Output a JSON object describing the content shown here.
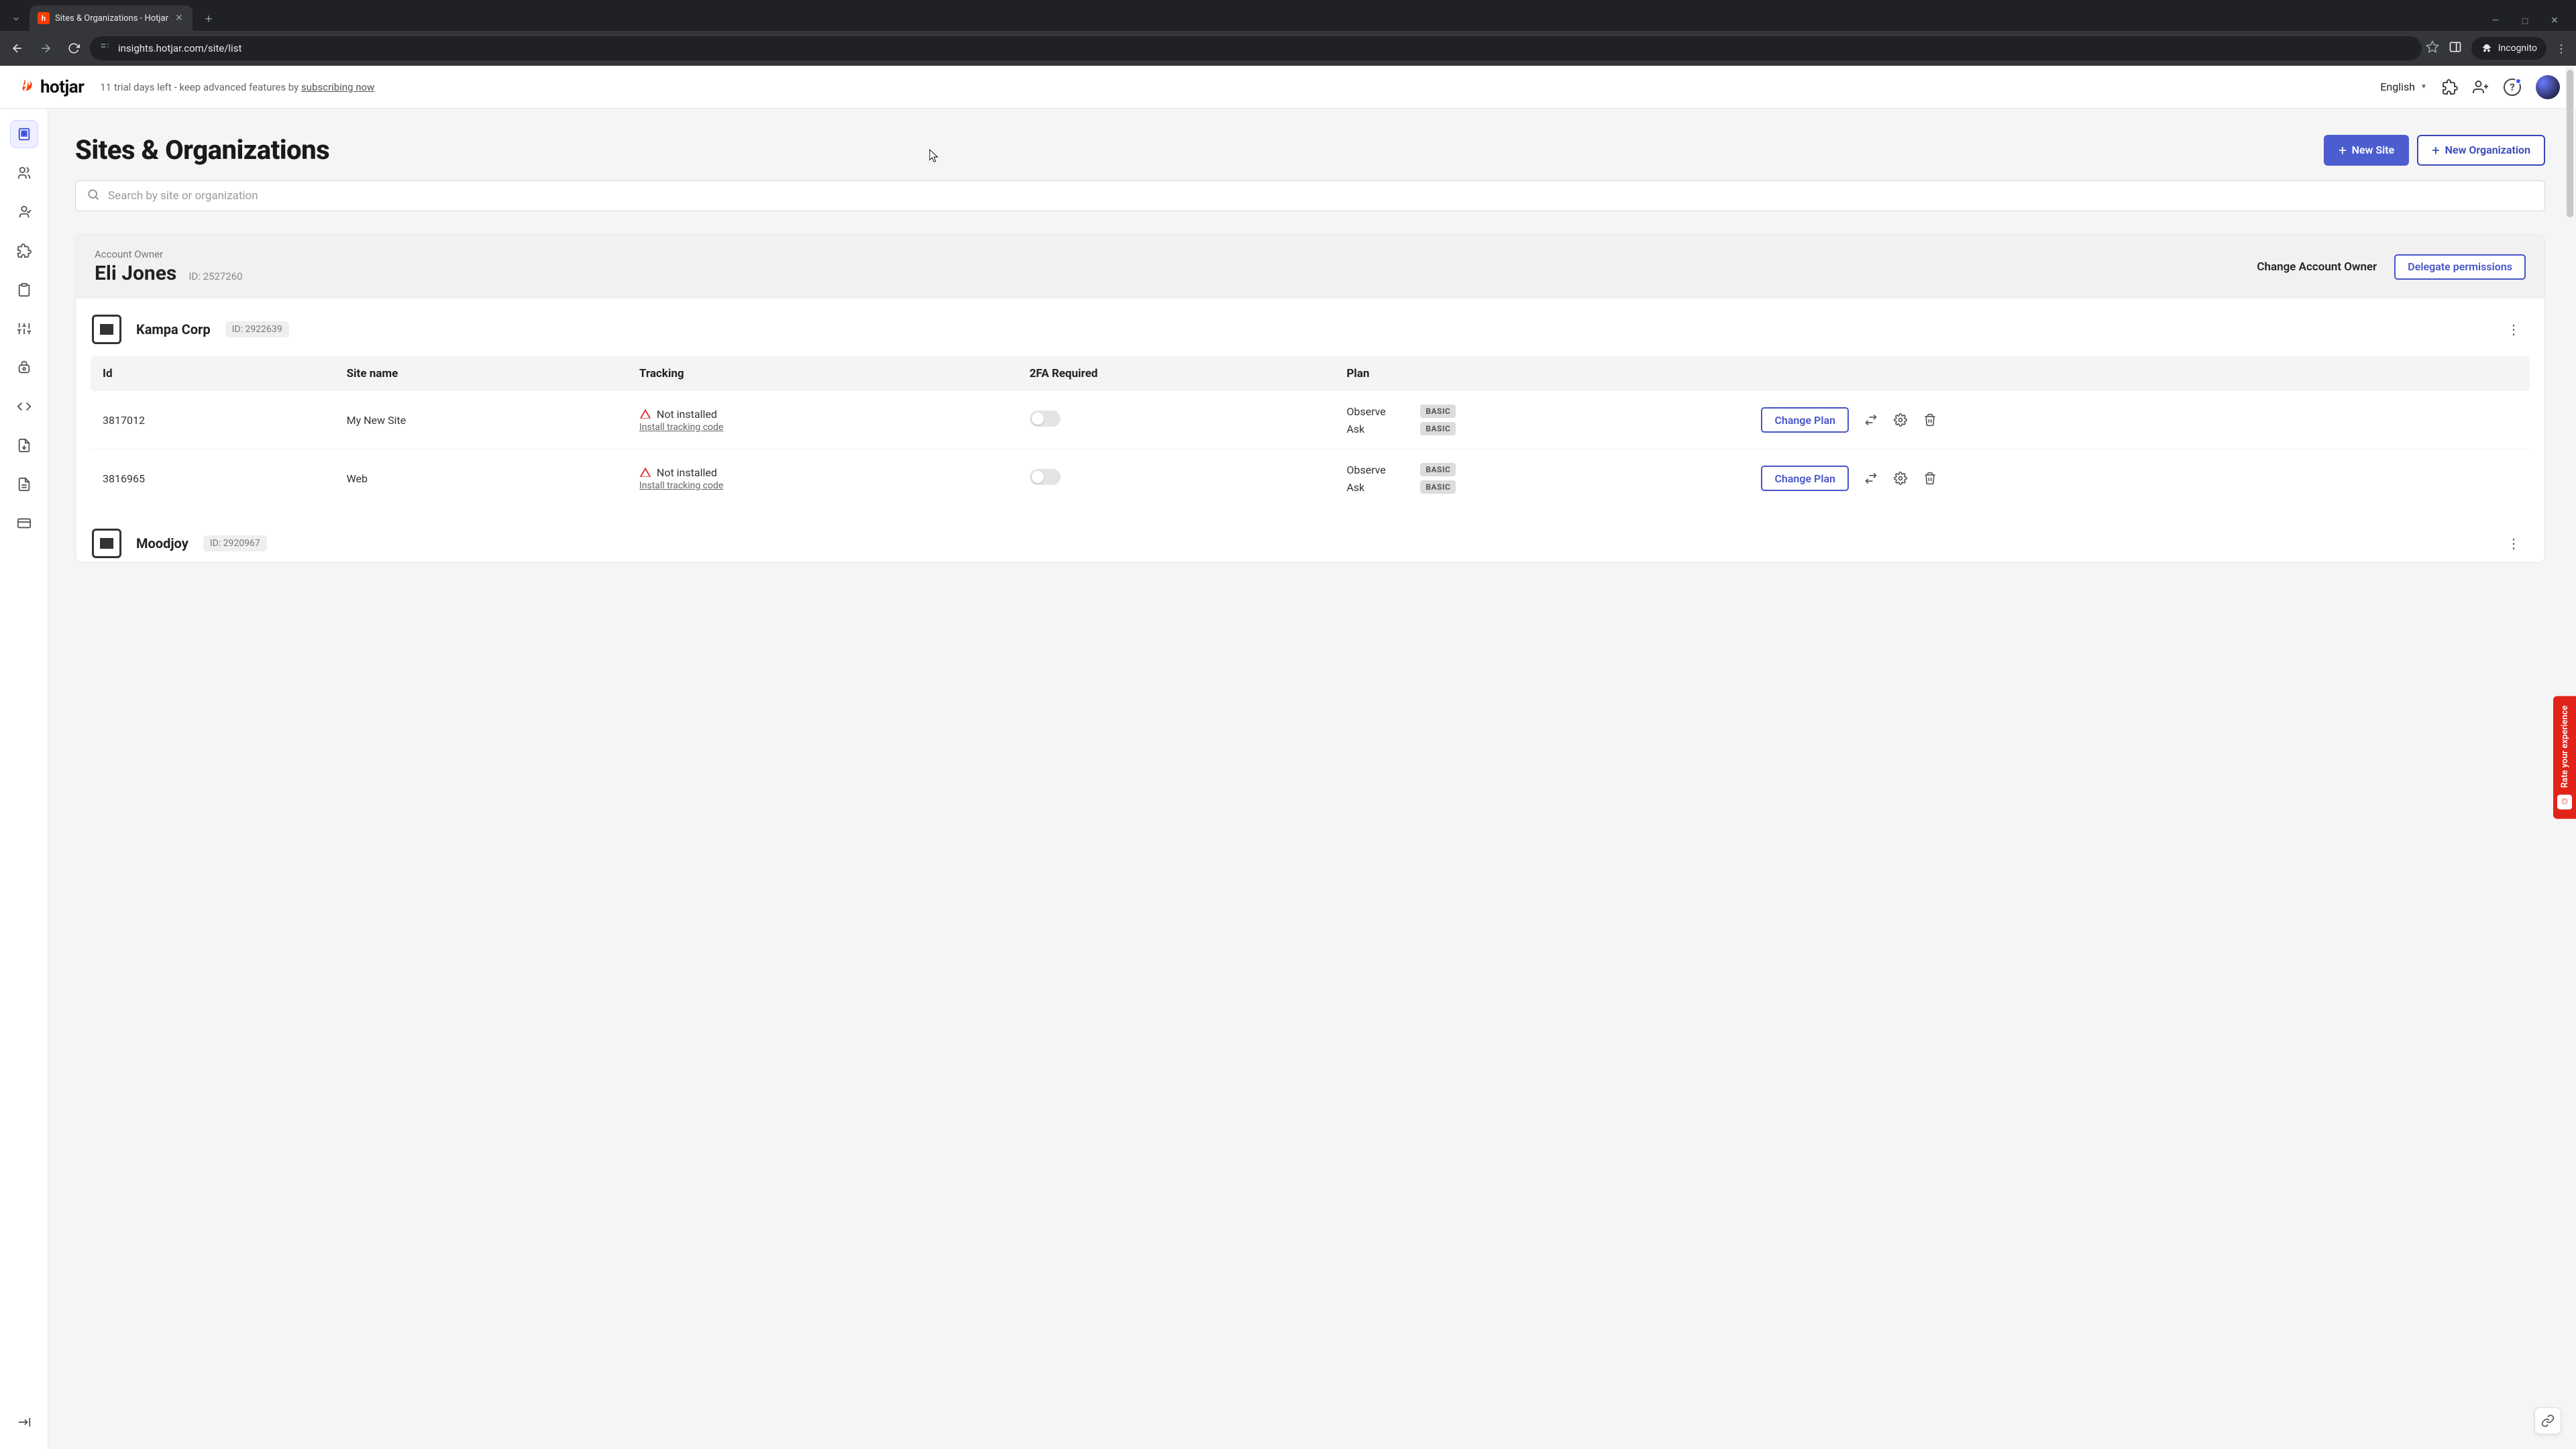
{
  "browser": {
    "tab_title": "Sites & Organizations - Hotjar",
    "url": "insights.hotjar.com/site/list",
    "incognito_label": "Incognito"
  },
  "topbar": {
    "brand": "hotjar",
    "trial_prefix": "11 trial days left - keep advanced features by ",
    "trial_link": "subscribing now",
    "language": "English"
  },
  "page": {
    "title": "Sites & Organizations",
    "new_site": "New Site",
    "new_org": "New Organization",
    "search_placeholder": "Search by site or organization"
  },
  "account": {
    "label": "Account Owner",
    "owner_name": "Eli Jones",
    "id_label": "ID: 2527260",
    "change_owner": "Change Account Owner",
    "delegate": "Delegate permissions"
  },
  "columns": {
    "id": "Id",
    "site_name": "Site name",
    "tracking": "Tracking",
    "twofa": "2FA Required",
    "plan": "Plan"
  },
  "tracking_status": "Not installed",
  "tracking_install": "Install tracking code",
  "plan_names": {
    "observe": "Observe",
    "ask": "Ask"
  },
  "plan_badge": "BASIC",
  "change_plan": "Change Plan",
  "orgs": [
    {
      "name": "Kampa Corp",
      "id_label": "ID: 2922639",
      "sites": [
        {
          "id": "3817012",
          "name": "My New Site"
        },
        {
          "id": "3816965",
          "name": "Web"
        }
      ]
    },
    {
      "name": "Moodjoy",
      "id_label": "ID: 2920967",
      "sites": []
    }
  ],
  "feedback": "Rate your experience",
  "icons": {
    "search": "search-icon",
    "plus": "plus-icon",
    "gear": "gear-icon",
    "trash": "trash-icon",
    "transfer": "transfer-icon",
    "kebab": "kebab-icon",
    "link": "link-icon",
    "warn": "warning-icon",
    "help": "help-icon",
    "puzzle": "puzzle-icon",
    "adduser": "add-user-icon",
    "language": "language-dropdown",
    "org": "org-icon"
  }
}
